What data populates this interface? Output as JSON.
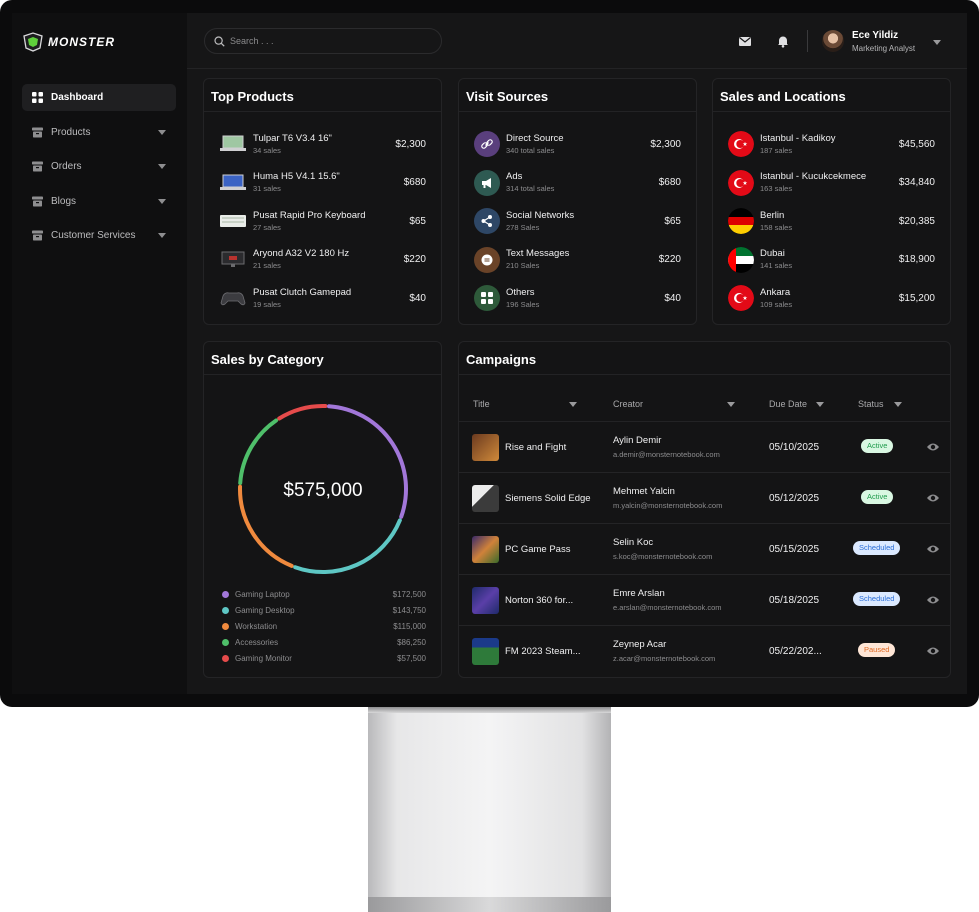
{
  "app": {
    "brand": "MONSTER"
  },
  "sidebar": {
    "items": [
      {
        "label": "Dashboard",
        "active": true,
        "icon": "grid-icon"
      },
      {
        "label": "Products",
        "icon": "box-icon"
      },
      {
        "label": "Orders",
        "icon": "box-icon"
      },
      {
        "label": "Blogs",
        "icon": "box-icon"
      },
      {
        "label": "Customer Services",
        "icon": "box-icon"
      }
    ]
  },
  "header": {
    "search_placeholder": "Search . . .",
    "user": {
      "name": "Ece Yildiz",
      "role": "Marketing Analyst"
    }
  },
  "top_products": {
    "title": "Top Products",
    "items": [
      {
        "name": "Tulpar T6 V3.4 16\"",
        "sub": "34 sales",
        "value": "$2,300"
      },
      {
        "name": "Huma H5 V4.1  15.6\"",
        "sub": "31 sales",
        "value": "$680"
      },
      {
        "name": "Pusat Rapid Pro Keyboard",
        "sub": "27 sales",
        "value": "$65"
      },
      {
        "name": "Aryond A32 V2 180 Hz",
        "sub": "21 sales",
        "value": "$220"
      },
      {
        "name": "Pusat Clutch Gamepad",
        "sub": "19 sales",
        "value": "$40"
      }
    ]
  },
  "visit_sources": {
    "title": "Visit Sources",
    "items": [
      {
        "name": "Direct Source",
        "sub": "340 total sales",
        "value": "$2,300",
        "color": "#5a3f7d",
        "icon": "link-icon"
      },
      {
        "name": "Ads",
        "sub": "314 total sales",
        "value": "$680",
        "color": "#2e5a52",
        "icon": "megaphone-icon"
      },
      {
        "name": "Social Networks",
        "sub": "278 Sales",
        "value": "$65",
        "color": "#2e4766",
        "icon": "share-icon"
      },
      {
        "name": "Text Messages",
        "sub": "210 Sales",
        "value": "$220",
        "color": "#6a4328",
        "icon": "message-icon"
      },
      {
        "name": "Others",
        "sub": "196 Sales",
        "value": "$40",
        "color": "#2e5a3a",
        "icon": "grid-icon"
      }
    ]
  },
  "sales_locations": {
    "title": "Sales  and Locations",
    "items": [
      {
        "name": "Istanbul - Kadikoy",
        "sub": "187 sales",
        "value": "$45,560",
        "flag": "turkey-flag-icon"
      },
      {
        "name": "Istanbul - Kucukcekmece",
        "sub": "163 sales",
        "value": "$34,840",
        "flag": "turkey-flag-icon"
      },
      {
        "name": "Berlin",
        "sub": "158 sales",
        "value": "$20,385",
        "flag": "germany-flag-icon"
      },
      {
        "name": "Dubai",
        "sub": "141 sales",
        "value": "$18,900",
        "flag": "uae-flag-icon"
      },
      {
        "name": "Ankara",
        "sub": "109 sales",
        "value": "$15,200",
        "flag": "turkey-flag-icon"
      }
    ]
  },
  "sales_by_category": {
    "title": "Sales by Category",
    "total": "$575,000",
    "items": [
      {
        "name": "Gaming Laptop",
        "value": "$172,500",
        "amount": 172500,
        "color": "#a277d9"
      },
      {
        "name": "Gaming Desktop",
        "value": "$143,750",
        "amount": 143750,
        "color": "#5ec7c4"
      },
      {
        "name": "Workstation",
        "value": "$115,000",
        "amount": 115000,
        "color": "#f08a3e"
      },
      {
        "name": "Accessories",
        "value": "$86,250",
        "amount": 86250,
        "color": "#4fbf6a"
      },
      {
        "name": "Gaming Monitor",
        "value": "$57,500",
        "amount": 57500,
        "color": "#e54b4b"
      }
    ]
  },
  "campaigns": {
    "title": "Campaigns",
    "columns": [
      "Title",
      "Creator",
      "Due Date",
      "Status"
    ],
    "rows": [
      {
        "title": "Rise and Fight",
        "creator": "Aylin Demir",
        "email": "a.demir@monsternotebook.com",
        "due": "05/10/2025",
        "status": "Active",
        "status_class": "active",
        "thumb": "#6b3a1f"
      },
      {
        "title": "Siemens Solid Edge",
        "creator": "Mehmet Yalcin",
        "email": "m.yalcin@monsternotebook.com",
        "due": "05/12/2025",
        "status": "Active",
        "status_class": "active",
        "thumb": "#5c5c55"
      },
      {
        "title": "PC Game Pass",
        "creator": "Selin Koc",
        "email": "s.koc@monsternotebook.com",
        "due": "05/15/2025",
        "status": "Scheduled",
        "status_class": "scheduled",
        "thumb": "#7a4a2a"
      },
      {
        "title": "Norton 360 for...",
        "creator": "Emre Arslan",
        "email": "e.arslan@monsternotebook.com",
        "due": "05/18/2025",
        "status": "Scheduled",
        "status_class": "scheduled",
        "thumb": "#2a2f6a"
      },
      {
        "title": "FM 2023 Steam...",
        "creator": "Zeynep Acar",
        "email": "z.acar@monsternotebook.com",
        "due": "05/22/202...",
        "status": "Paused",
        "status_class": "paused",
        "thumb": "#1f4a2a"
      }
    ]
  }
}
